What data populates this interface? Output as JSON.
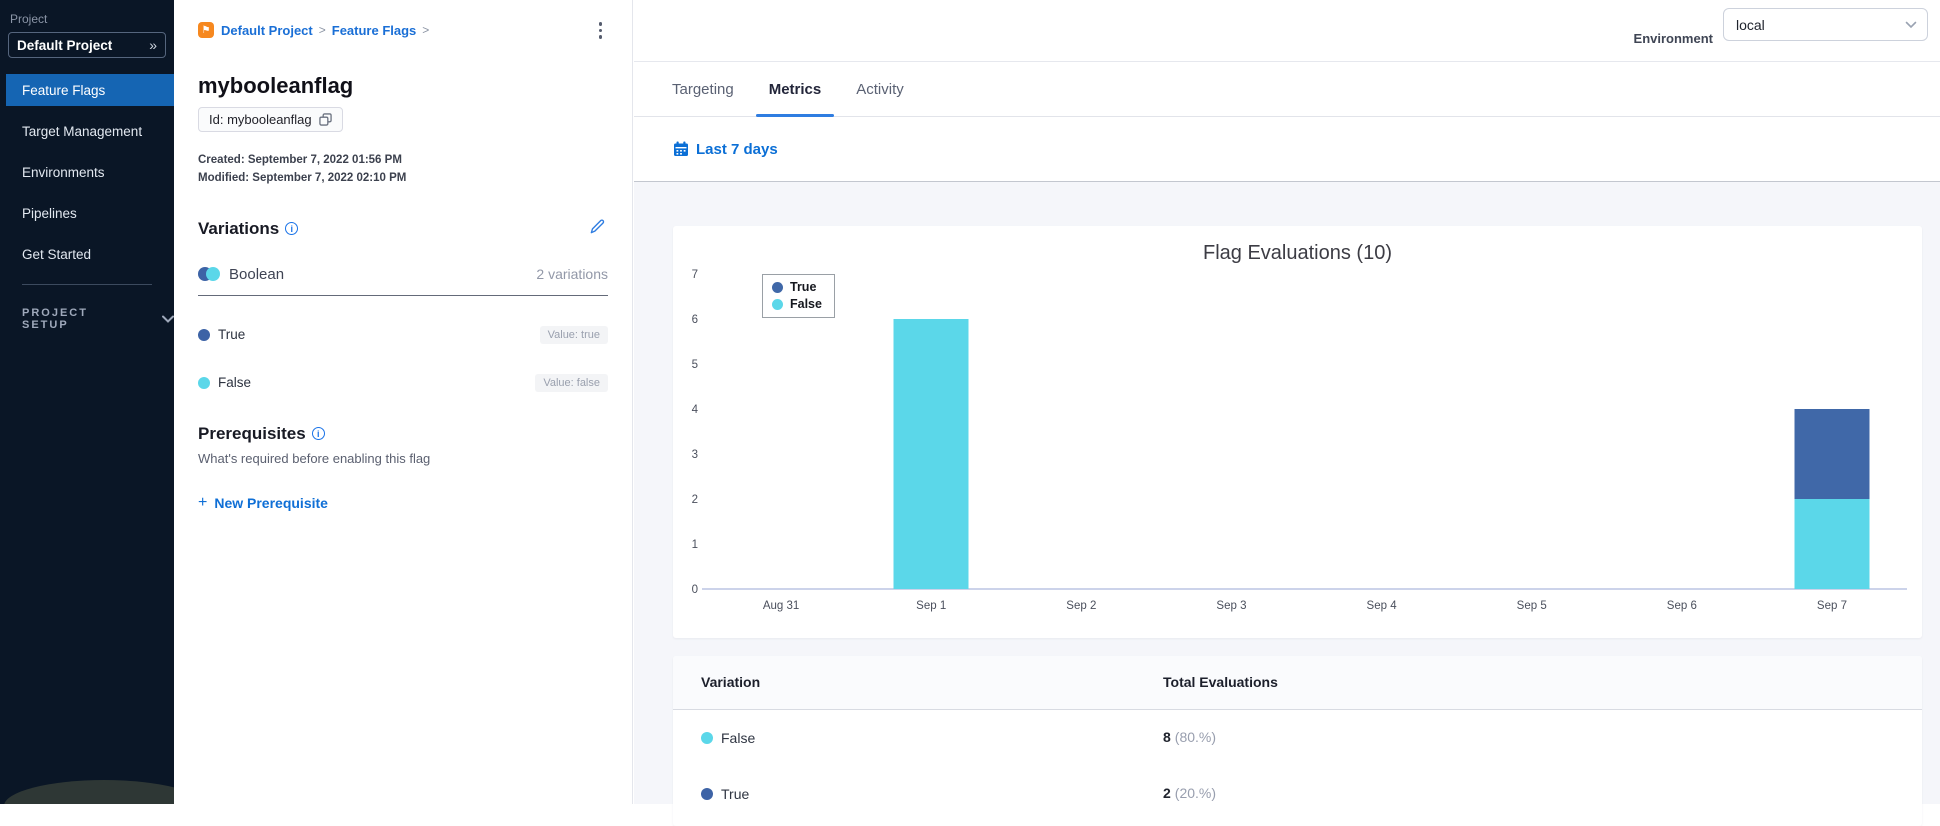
{
  "sidebar": {
    "project_label": "Project",
    "project_selector": "Default Project",
    "items": [
      {
        "label": "Feature Flags",
        "active": true
      },
      {
        "label": "Target Management",
        "active": false
      },
      {
        "label": "Environments",
        "active": false
      },
      {
        "label": "Pipelines",
        "active": false
      },
      {
        "label": "Get Started",
        "active": false
      }
    ],
    "section_label": "PROJECT SETUP"
  },
  "breadcrumb": {
    "project": "Default Project",
    "section": "Feature Flags",
    "separator": ">"
  },
  "kebab_menu": "",
  "flag": {
    "title": "mybooleanflag",
    "id_chip": "Id: mybooleanflag",
    "created": "Created: September 7, 2022 01:56 PM",
    "modified": "Modified: September 7, 2022 02:10 PM"
  },
  "variations": {
    "title": "Variations",
    "type_label": "Boolean",
    "count_label": "2 variations",
    "items": [
      {
        "name": "True",
        "value_label": "Value: true",
        "color": "#3d63a6"
      },
      {
        "name": "False",
        "value_label": "Value: false",
        "color": "#5bd7e9"
      }
    ]
  },
  "prerequisites": {
    "title": "Prerequisites",
    "description": "What's required before enabling this flag",
    "new_button_label": "New Prerequisite"
  },
  "environment": {
    "label": "Environment",
    "selected": "local"
  },
  "tabs": [
    {
      "label": "Targeting",
      "active": false
    },
    {
      "label": "Metrics",
      "active": true
    },
    {
      "label": "Activity",
      "active": false
    }
  ],
  "date_filter_label": "Last 7 days",
  "chart_data": {
    "type": "bar",
    "stacked": true,
    "title": "Flag Evaluations (10)",
    "categories": [
      "Aug 31",
      "Sep 1",
      "Sep 2",
      "Sep 3",
      "Sep 4",
      "Sep 5",
      "Sep 6",
      "Sep 7"
    ],
    "series": [
      {
        "name": "True",
        "color": "#4068a8",
        "values": [
          0,
          0,
          0,
          0,
          0,
          0,
          0,
          2
        ]
      },
      {
        "name": "False",
        "color": "#5bd7e9",
        "values": [
          0,
          6,
          0,
          0,
          0,
          0,
          0,
          2
        ]
      }
    ],
    "xlabel": "",
    "ylabel": "",
    "ylim": [
      0,
      7
    ],
    "yticks": [
      0,
      1,
      2,
      3,
      4,
      5,
      6,
      7
    ],
    "legend_position": "top-left",
    "grid": false
  },
  "metrics_table": {
    "columns": [
      "Variation",
      "Total Evaluations"
    ],
    "rows": [
      {
        "variation": "False",
        "color": "#5bd7e9",
        "total": "8",
        "percent": "(80.%)"
      },
      {
        "variation": "True",
        "color": "#3d63a6",
        "total": "2",
        "percent": "(20.%)"
      }
    ]
  },
  "accent_colors": {
    "link_blue": "#1a6fd6",
    "active_nav": "#1565b3",
    "tab_underline": "#2f7de1"
  }
}
